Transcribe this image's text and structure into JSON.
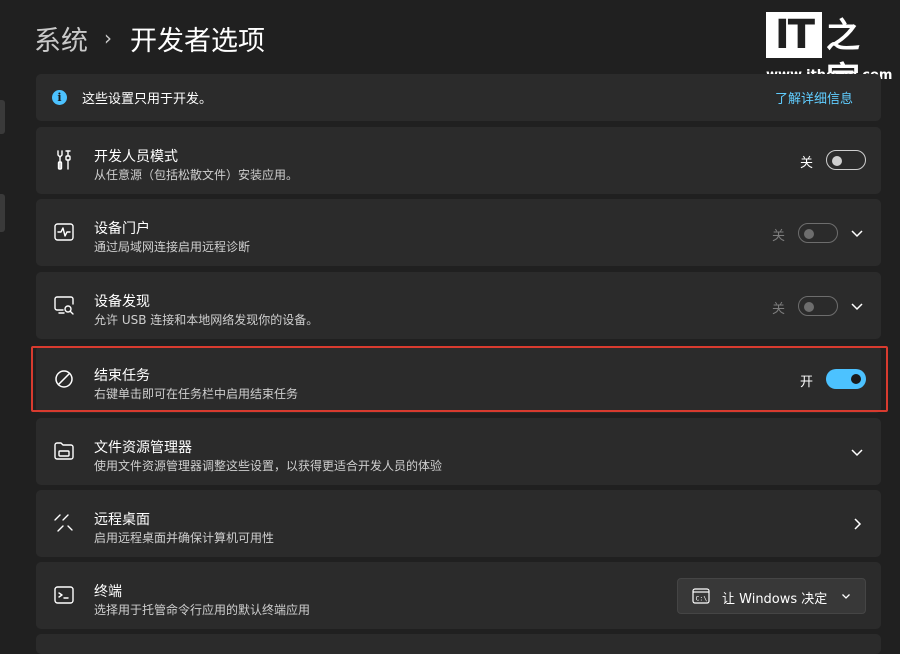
{
  "breadcrumb": {
    "parent": "系统",
    "separator": "›",
    "current": "开发者选项"
  },
  "watermark": {
    "logo_it": "IT",
    "logo_cn": "之家",
    "url": "www.ithome.com"
  },
  "info": {
    "text": "这些设置只用于开发。",
    "link": "了解详细信息",
    "icon": "info-icon"
  },
  "rows": [
    {
      "title": "开发人员模式",
      "desc": "从任意源（包括松散文件）安装应用。",
      "state": "关",
      "toggle": "off",
      "icon": "tools-icon"
    },
    {
      "title": "设备门户",
      "desc": "通过局域网连接启用远程诊断",
      "state": "关",
      "toggle": "disabled",
      "icon": "device-portal-icon"
    },
    {
      "title": "设备发现",
      "desc": "允许 USB 连接和本地网络发现你的设备。",
      "state": "关",
      "toggle": "disabled",
      "icon": "device-discovery-icon"
    },
    {
      "title": "结束任务",
      "desc": "右键单击即可在任务栏中启用结束任务",
      "state": "开",
      "toggle": "on",
      "icon": "end-task-icon"
    },
    {
      "title": "文件资源管理器",
      "desc": "使用文件资源管理器调整这些设置，以获得更适合开发人员的体验",
      "icon": "folder-icon"
    },
    {
      "title": "远程桌面",
      "desc": "启用远程桌面并确保计算机可用性",
      "icon": "remote-desktop-icon"
    },
    {
      "title": "终端",
      "desc": "选择用于托管命令行应用的默认终端应用",
      "icon": "terminal-icon"
    }
  ],
  "terminal_dropdown": {
    "value": "让 Windows 决定",
    "icon": "terminal-app-icon"
  },
  "colors": {
    "accent": "#4cc2ff",
    "link": "#60cdff",
    "highlight": "#d83b2f",
    "background": "#202020",
    "card": "#2b2b2b"
  }
}
